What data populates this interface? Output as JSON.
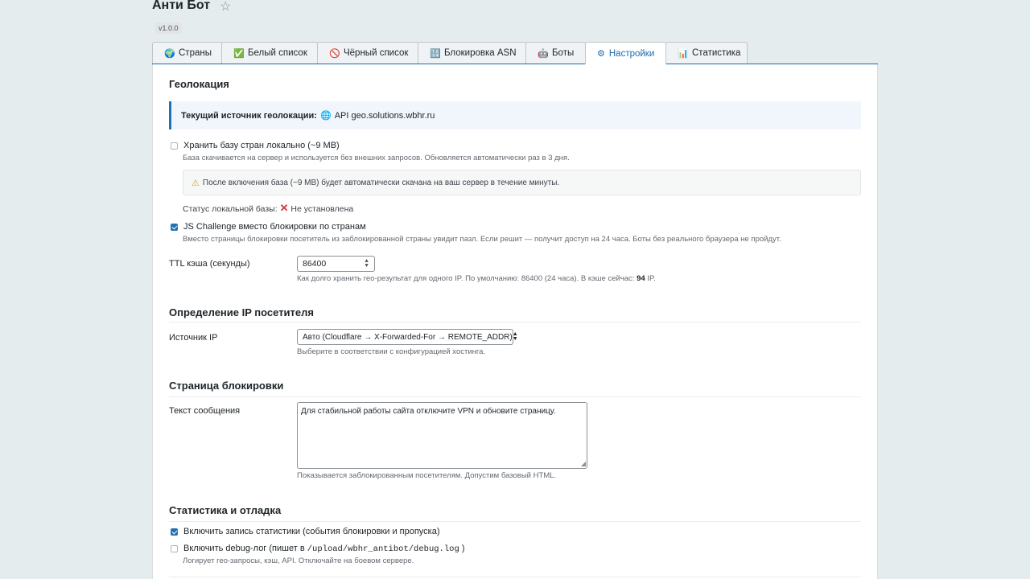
{
  "header": {
    "title": "Анти Бот",
    "star_icon": "star-icon",
    "version": "v1.0.0"
  },
  "tabs": [
    {
      "icon": "🌍",
      "icon_name": "globe-icon",
      "label": "Страны",
      "active": false
    },
    {
      "icon": "✅",
      "icon_name": "check-icon",
      "label": "Белый список",
      "active": false
    },
    {
      "icon": "🚫",
      "icon_name": "prohibited-icon",
      "label": "Чёрный список",
      "active": false
    },
    {
      "icon": "🔢",
      "icon_name": "numbers-icon",
      "label": "Блокировка ASN",
      "active": false
    },
    {
      "icon": "🤖",
      "icon_name": "robot-icon",
      "label": "Боты",
      "active": false
    },
    {
      "icon": "⚙",
      "icon_name": "gear-icon",
      "label": "Настройки",
      "active": true
    },
    {
      "icon": "📊",
      "icon_name": "bar-chart-icon",
      "label": "Статистика",
      "active": false
    }
  ],
  "geo": {
    "title": "Геолокация",
    "source_label": "Текущий источник геолокации:",
    "source_value": "API geo.solutions.wbhr.ru",
    "local_db_label": "Хранить базу стран локально (~9 MB)",
    "local_db_checked": false,
    "local_db_hint": "База скачивается на сервер и используется без внешних запросов. Обновляется автоматически раз в 3 дня.",
    "warning": "После включения база (~9 MB) будет автоматически скачана на ваш сервер в течение минуты.",
    "status_label": "Статус локальной базы:",
    "status_value": "Не установлена",
    "js_label": "JS Challenge вместо блокировки по странам",
    "js_checked": true,
    "js_hint": "Вместо страницы блокировки посетитель из заблокированной страны увидит пазл. Если решит — получит доступ на 24 часа. Боты без реального браузера не пройдут.",
    "ttl_label": "TTL кэша (секунды)",
    "ttl_value": "86400",
    "ttl_hint_prefix": "Как долго хранить гео-результат для одного IP. По умолчанию: 86400 (24 часа). В кэше сейчас:",
    "ttl_cache_count": "94",
    "ttl_hint_suffix": "IP."
  },
  "ip": {
    "title": "Определение IP посетителя",
    "source_label": "Источник IP",
    "source_value": "Авто (Cloudflare → X-Forwarded-For → REMOTE_ADDR)",
    "source_hint": "Выберите в соответствии с конфигурацией хостинга."
  },
  "block_page": {
    "title": "Страница блокировки",
    "message_label": "Текст сообщения",
    "message_value": "Для стабильной работы сайта отключите VPN и обновите страницу.",
    "message_hint": "Показывается заблокированным посетителям. Допустим базовый HTML."
  },
  "stats": {
    "title": "Статистика и отладка",
    "stats_label": "Включить запись статистики (события блокировки и пропуска)",
    "stats_checked": true,
    "debug_label_prefix": "Включить debug-лог (пишет в",
    "debug_path": "/upload/wbhr_antibot/debug.log",
    "debug_label_suffix": ")",
    "debug_checked": false,
    "debug_hint": "Логирует гео-запросы, кэш, API. Отключайте на боевом сервере."
  },
  "colors": {
    "accent": "#2271b1",
    "background": "#e4ecee",
    "error": "#d63638",
    "warning": "#dba617"
  }
}
